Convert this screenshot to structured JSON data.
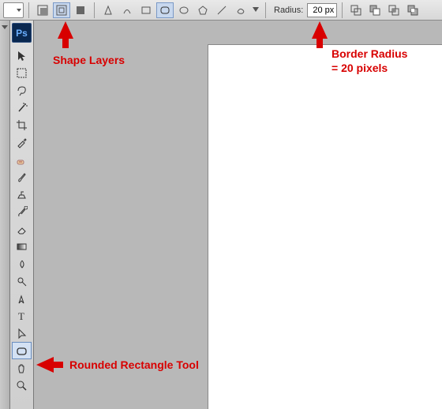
{
  "optionsBar": {
    "radiusLabel": "Radius:",
    "radiusValue": "20 px"
  },
  "annotations": {
    "shapeLayers": "Shape Layers",
    "borderRadius": "Border Radius\n= 20 pixels",
    "roundedRect": "Rounded Rectangle Tool"
  },
  "tools": [
    "move",
    "marquee",
    "lasso",
    "magic-wand",
    "crop",
    "eyedropper",
    "healing-brush",
    "brush",
    "clone-stamp",
    "history-brush",
    "eraser",
    "gradient",
    "blur",
    "dodge",
    "pen",
    "type",
    "path-select",
    "rounded-rectangle",
    "hand",
    "zoom"
  ],
  "selectedTool": "rounded-rectangle",
  "modeSelected": "shape-layers"
}
